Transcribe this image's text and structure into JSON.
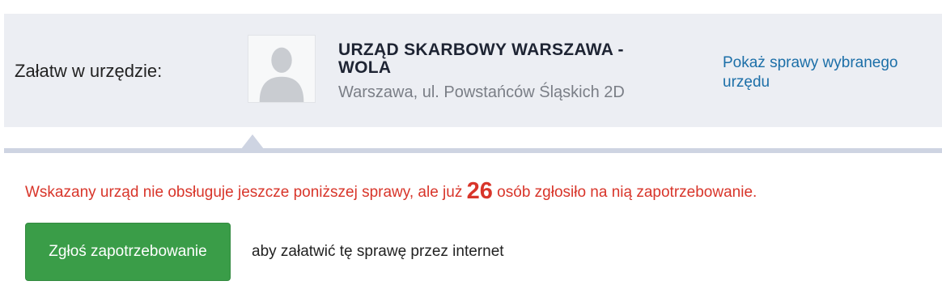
{
  "panel": {
    "label": "Załatw w urzędzie:",
    "office": {
      "name": "URZĄD SKARBOWY WARSZAWA - WOLA",
      "address": "Warszawa, ul. Powstańców Śląskich 2D",
      "avatar_icon": "user-placeholder-icon"
    },
    "show_cases_link": "Pokaż sprawy wybranego urzędu"
  },
  "notice": {
    "text_before": "Wskazany urząd nie obsługuje jeszcze poniższej sprawy, ale już ",
    "count": "26",
    "text_after": " osób zgłosiło na nią zapotrzebowanie."
  },
  "action": {
    "button_label": "Zgłoś zapotrzebowanie",
    "caption": "aby załatwić tę sprawę przez internet"
  },
  "colors": {
    "panel_bg": "#eceef3",
    "link": "#1c6fa8",
    "alert": "#d8352a",
    "button": "#3a9d48"
  }
}
